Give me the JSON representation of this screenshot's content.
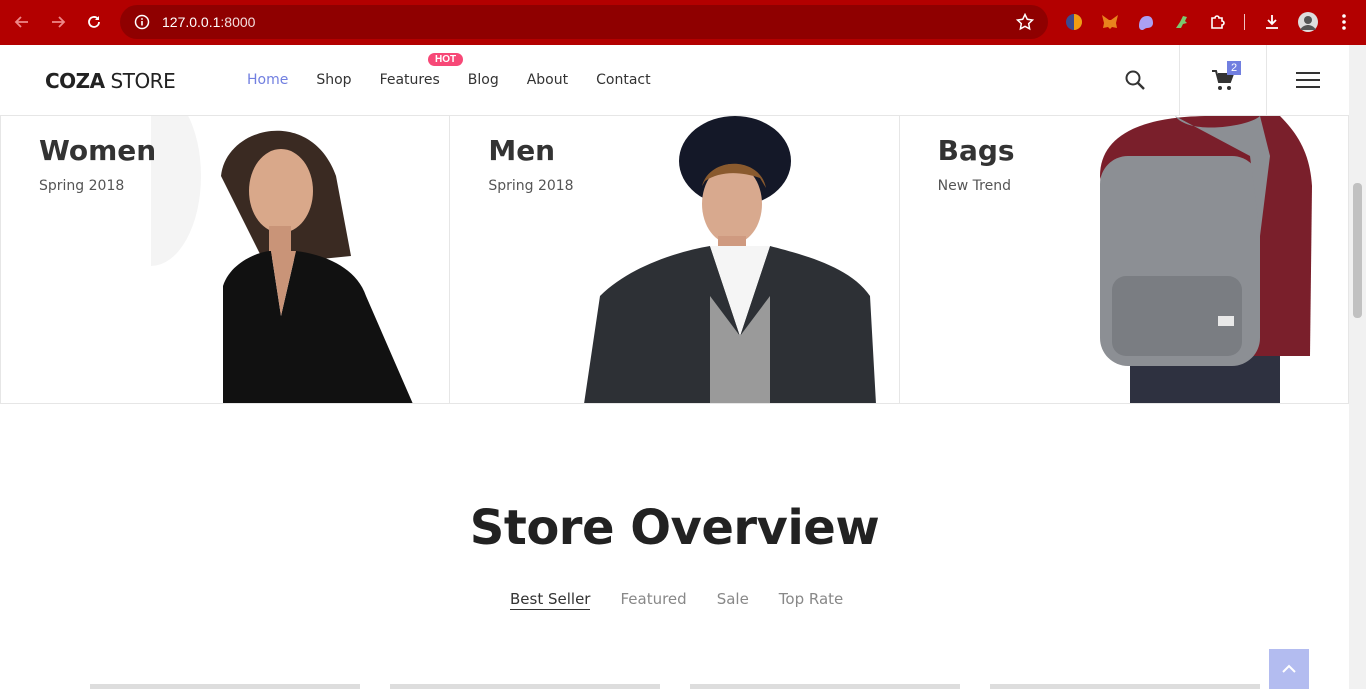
{
  "browser": {
    "url_host": "127.0.0.1",
    "url_port": ":8000"
  },
  "site": {
    "logo_bold": "COZA",
    "logo_light": " STORE",
    "menu": [
      {
        "label": "Home"
      },
      {
        "label": "Shop"
      },
      {
        "label": "Features"
      },
      {
        "label": "Blog"
      },
      {
        "label": "About"
      },
      {
        "label": "Contact"
      }
    ],
    "hot_badge": "HOT",
    "cart_count": "2"
  },
  "banners": [
    {
      "title": "Women",
      "subtitle": "Spring 2018"
    },
    {
      "title": "Men",
      "subtitle": "Spring 2018"
    },
    {
      "title": "Bags",
      "subtitle": "New Trend"
    }
  ],
  "overview": {
    "title": "Store Overview",
    "tabs": [
      {
        "label": "Best Seller"
      },
      {
        "label": "Featured"
      },
      {
        "label": "Sale"
      },
      {
        "label": "Top Rate"
      }
    ]
  },
  "colors": {
    "chrome": "#b30000",
    "accent": "#717fe0",
    "hot": "#f74877"
  }
}
